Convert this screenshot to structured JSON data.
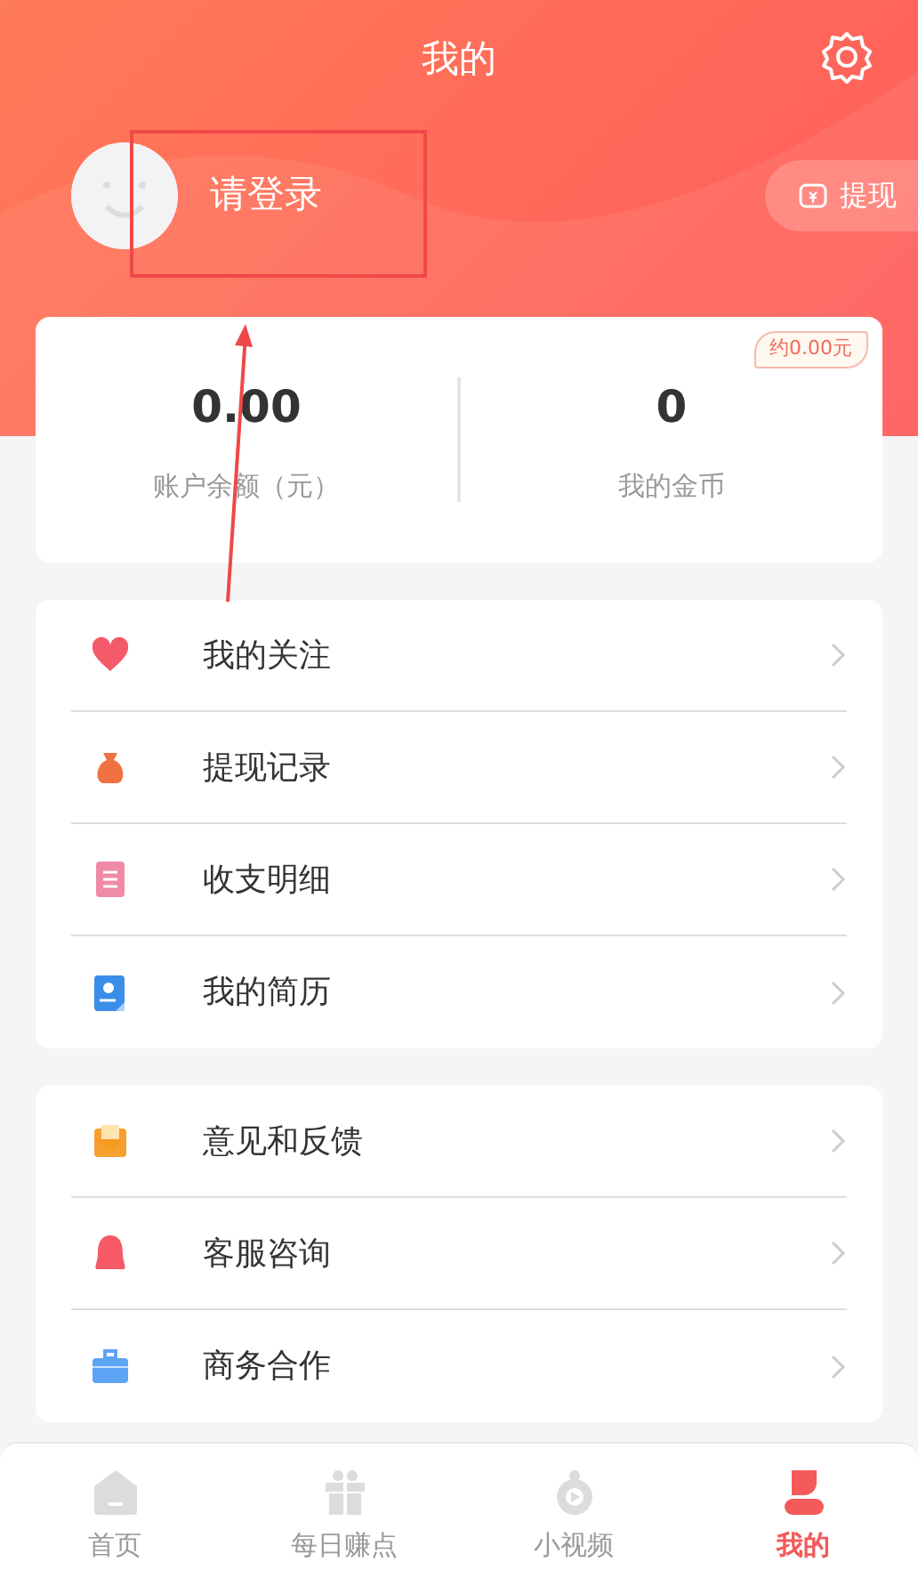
{
  "header": {
    "title": "我的",
    "user": {
      "label": "请登录"
    },
    "withdraw_button": "提现"
  },
  "account": {
    "badge": "约0.00元",
    "stats": [
      {
        "value": "0.00",
        "label": "账户余额（元）"
      },
      {
        "value": "0",
        "label": "我的金币"
      }
    ]
  },
  "menu_groups": [
    [
      {
        "label": "我的关注"
      },
      {
        "label": "提现记录"
      },
      {
        "label": "收支明细"
      },
      {
        "label": "我的简历"
      }
    ],
    [
      {
        "label": "意见和反馈"
      },
      {
        "label": "客服咨询"
      },
      {
        "label": "商务合作"
      }
    ]
  ],
  "tab_bar": [
    {
      "label": "首页",
      "selected": false
    },
    {
      "label": "每日赚点",
      "selected": false
    },
    {
      "label": "小视频",
      "selected": false
    },
    {
      "label": "我的",
      "selected": true
    }
  ]
}
